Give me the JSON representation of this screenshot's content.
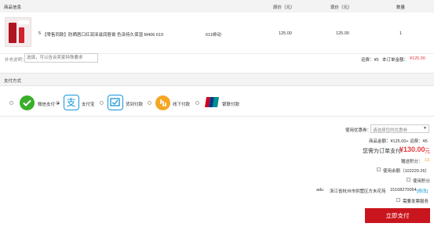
{
  "table": {
    "headers": {
      "product": "商品信息",
      "original_price": "原价（元）",
      "current_price": "现价（元）",
      "quantity": "数量"
    },
    "row": {
      "name": "【零售同款】防晒唇口红润泽滋润唇膏 色泽持久保湿 M406 619",
      "spec": "611绯动",
      "original_price": "125.00",
      "current_price": "125.00",
      "quantity": "1",
      "prefix": "5"
    }
  },
  "remark": {
    "label": "补充说明：",
    "placeholder": "选填，可以告诉卖家特殊要求",
    "shipping_text": "运费：¥5",
    "store_total_label": "本订单金额：",
    "store_total_value": "¥125.00"
  },
  "payment": {
    "section_title": "支付方式",
    "methods": [
      {
        "label": "微信支付",
        "icon": "wechat-pay-icon",
        "color": "#3aae2a",
        "selected": false
      },
      {
        "label": "支付宝",
        "icon": "alipay-icon",
        "color": "#1296db",
        "selected": true
      },
      {
        "label": "货到付款",
        "icon": "cash-on-delivery-icon",
        "color": "#1296db",
        "selected": false
      },
      {
        "label": "线下付款",
        "icon": "offline-payment-icon",
        "color": "#f5a623",
        "selected": false
      },
      {
        "label": "银联付款",
        "icon": "unionpay-icon",
        "color": "#d0021b",
        "selected": false
      }
    ]
  },
  "summary": {
    "coupon_label": "使用优惠券：",
    "coupon_placeholder": "请选择您的优惠券",
    "goods_total": "商品金额：¥125.00+ 运费：¥5",
    "payable_label": "您需为订单支付:",
    "payable_value": "¥130.00",
    "payable_unit": "元",
    "points_label": "赠送积分：",
    "points_value": "13",
    "use_balance_label": "使用余额（102220.26）",
    "use_points_label": "使用积分",
    "address_name": "adu",
    "address_text": "浙江省杭州市拱墅区方未花苑",
    "address_phone": "15168270054",
    "address_modify": "[修改]",
    "invoice_label": "需要发票服务",
    "submit_label": "立即支付"
  },
  "colors": {
    "accent": "#e4393c",
    "header_bg": "#f3f3f3",
    "submit_bg": "#c9151e"
  }
}
